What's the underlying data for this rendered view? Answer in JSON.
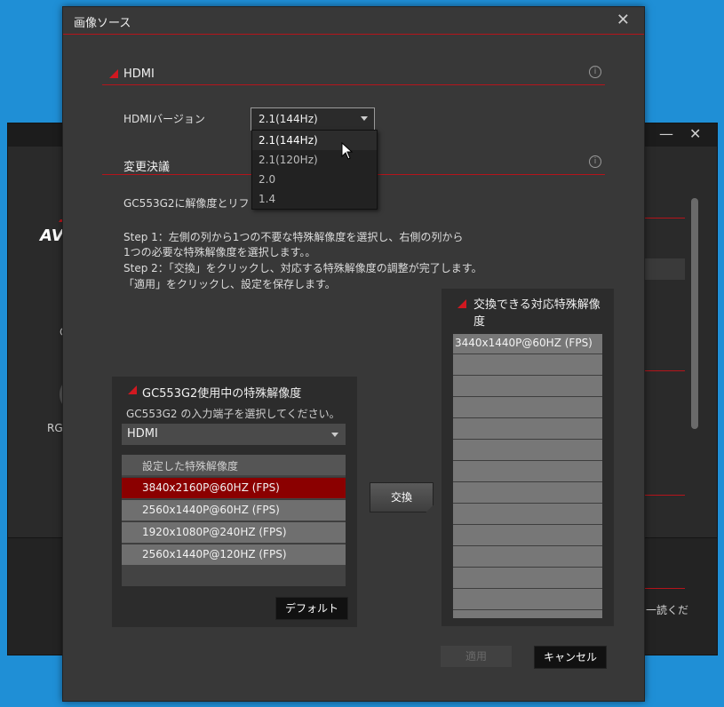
{
  "background_window": {
    "minimize": "—",
    "close": "✕",
    "logo": "AV",
    "side_labels": [
      "C",
      "RG"
    ],
    "bottom_right_text": "に一読くだ"
  },
  "dialog": {
    "title": "画像ソース",
    "close": "✕",
    "hdmi_section": {
      "title": "HDMI",
      "info": "i",
      "version_label": "HDMIバージョン",
      "version_value": "2.1(144Hz)",
      "options": [
        "2.1(144Hz)",
        "2.1(120Hz)",
        "2.0",
        "1.4"
      ]
    },
    "change_section": {
      "title": "変更決議",
      "info": "i",
      "notice": "GC553G2に解像度とリフレ",
      "steps": [
        "Step 1：左側の列から1つの不要な特殊解像度を選択し、右側の列から",
        "1つの必要な特殊解像度を選択します。。",
        "Step 2：「交換」をクリックし、対応する特殊解像度の調整が完了します。",
        "「適用」をクリックし、設定を保存します。"
      ]
    },
    "left_panel": {
      "title": "GC553G2使用中の特殊解像度",
      "hint": "GC553G2 の入力端子を選択してください。",
      "input_value": "HDMI",
      "table_header": "設定した特殊解像度",
      "rows": [
        "3840x2160P@60HZ (FPS)",
        "2560x1440P@60HZ (FPS)",
        "1920x1080P@240HZ (FPS)",
        "2560x1440P@120HZ (FPS)"
      ],
      "default_button": "デフォルト"
    },
    "swap_button": "交換",
    "right_panel": {
      "title": "交換できる対応特殊解像度",
      "rows": [
        "3440x1440P@60HZ (FPS)",
        "",
        "",
        "",
        "",
        "",
        "",
        "",
        "",
        "",
        "",
        "",
        "",
        ""
      ]
    },
    "apply_button": "適用",
    "cancel_button": "キャンセル"
  },
  "colors": {
    "accent": "#b5141b",
    "highlight_row": "#8b0000",
    "desktop": "#1f8fd6"
  }
}
